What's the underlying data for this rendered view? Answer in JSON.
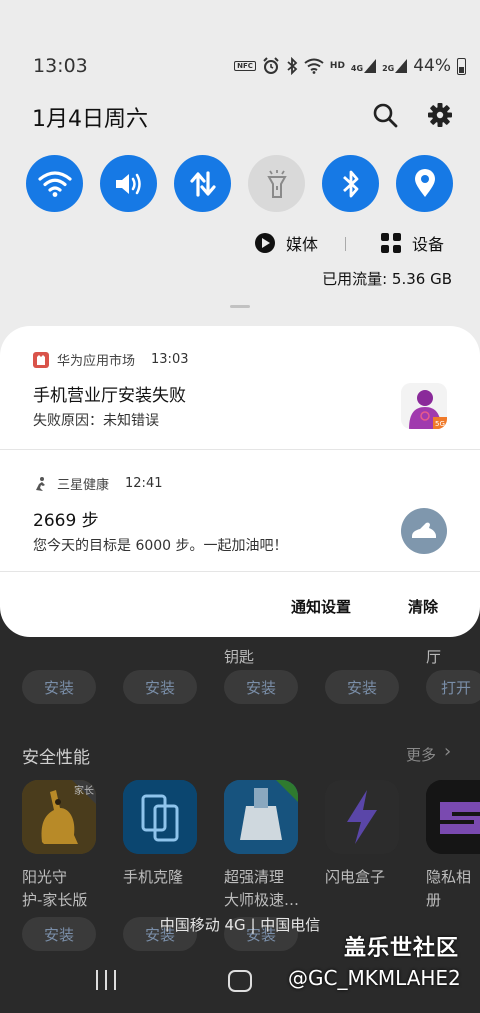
{
  "status_bar": {
    "time": "13:03",
    "nfc": "NFC",
    "signal1": "4G",
    "signal2": "2G",
    "battery": "44%"
  },
  "quick_panel": {
    "date": "1月4日周六",
    "toggles": [
      {
        "name": "wifi",
        "state": "on",
        "icon": "wifi-icon"
      },
      {
        "name": "sound",
        "state": "on",
        "icon": "volume-icon"
      },
      {
        "name": "mobile-data",
        "state": "on",
        "icon": "data-arrows-icon"
      },
      {
        "name": "flashlight",
        "state": "off",
        "icon": "flashlight-icon"
      },
      {
        "name": "bluetooth",
        "state": "on",
        "icon": "bluetooth-icon"
      },
      {
        "name": "location",
        "state": "on",
        "icon": "location-icon"
      }
    ],
    "media_label": "媒体",
    "devices_label": "设备",
    "data_usage": "已用流量: 5.36 GB",
    "accent": "#1679e5"
  },
  "notifications": [
    {
      "app": "华为应用市场",
      "time": "13:03",
      "title": "手机营业厅安装失败",
      "body": "失败原因：未知错误"
    },
    {
      "app": "三星健康",
      "time": "12:41",
      "title": "2669 步",
      "body": "您今天的目标是 6000 步。一起加油吧！"
    }
  ],
  "notification_actions": {
    "settings": "通知设置",
    "clear": "清除"
  },
  "background_app": {
    "row1_labels": [
      "钥匙",
      "厅"
    ],
    "install_label": "安装",
    "open_label": "打开",
    "section_title": "安全性能",
    "more_label": "更多",
    "apps": [
      {
        "name_line1": "阳光守",
        "name_line2": "护-家长版",
        "badge": "家长"
      },
      {
        "name_line1": "手机克隆",
        "name_line2": ""
      },
      {
        "name_line1": "超强清理",
        "name_line2": "大师极速…"
      },
      {
        "name_line1": "闪电盒子",
        "name_line2": ""
      },
      {
        "name_line1": "隐私相册",
        "name_line2": ""
      }
    ]
  },
  "carrier": "中国移动 4G | 中国电信",
  "watermark": {
    "line1": "盖乐世社区",
    "line2": "@GC_MKMLAHE2"
  }
}
